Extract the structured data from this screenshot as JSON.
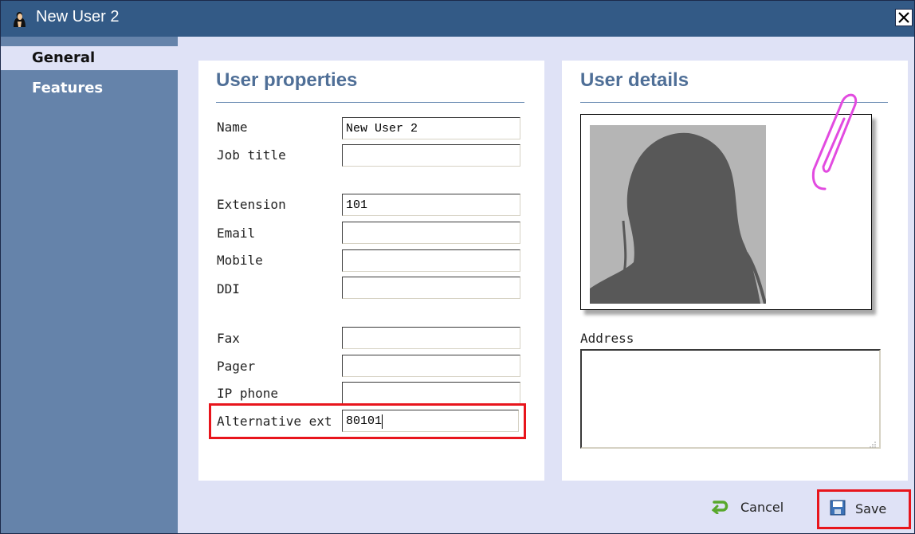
{
  "window": {
    "title": "New User 2"
  },
  "sidebar": {
    "items": [
      {
        "label": "General"
      },
      {
        "label": "Features"
      }
    ]
  },
  "user_properties": {
    "title": "User properties",
    "fields": [
      {
        "label": "Name",
        "value": "New User 2"
      },
      {
        "label": "Job title",
        "value": ""
      },
      {
        "label": "Extension",
        "value": "101"
      },
      {
        "label": "Email",
        "value": ""
      },
      {
        "label": "Mobile",
        "value": ""
      },
      {
        "label": "DDI",
        "value": ""
      },
      {
        "label": "Fax",
        "value": ""
      },
      {
        "label": "Pager",
        "value": ""
      },
      {
        "label": "IP phone",
        "value": ""
      },
      {
        "label": "Alternative ext",
        "value": "80101"
      }
    ]
  },
  "user_details": {
    "title": "User details",
    "address_label": "Address",
    "address_value": ""
  },
  "footer": {
    "cancel_label": "Cancel",
    "save_label": "Save"
  },
  "colors": {
    "titlebar": "#335a86",
    "sidebar": "#6583aa",
    "accent_text": "#4f6f97",
    "highlight": "#e8151c"
  },
  "icons": [
    "user-avatar-icon",
    "close-icon",
    "paperclip-icon",
    "cancel-arrow-icon",
    "save-disk-icon"
  ]
}
